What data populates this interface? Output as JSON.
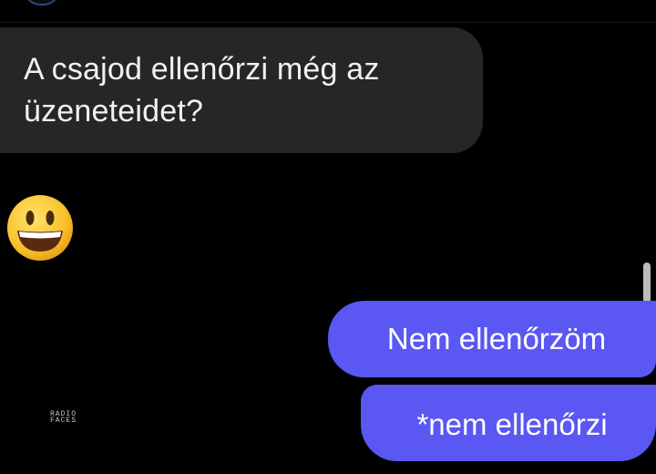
{
  "conversation": {
    "incoming_message": "A csajod ellenőrzi még az üzeneteidet?",
    "emoji_reply": "smiling-face-with-open-mouth-icon",
    "outgoing_messages": [
      "Nem ellenőrzöm",
      "*nem ellenőrzi"
    ]
  },
  "watermark": {
    "line1": "RADIO",
    "line2": "FACES"
  },
  "colors": {
    "background": "#000000",
    "incoming_bubble": "#262626",
    "outgoing_bubble": "#5a57f3",
    "text": "#ffffff"
  }
}
